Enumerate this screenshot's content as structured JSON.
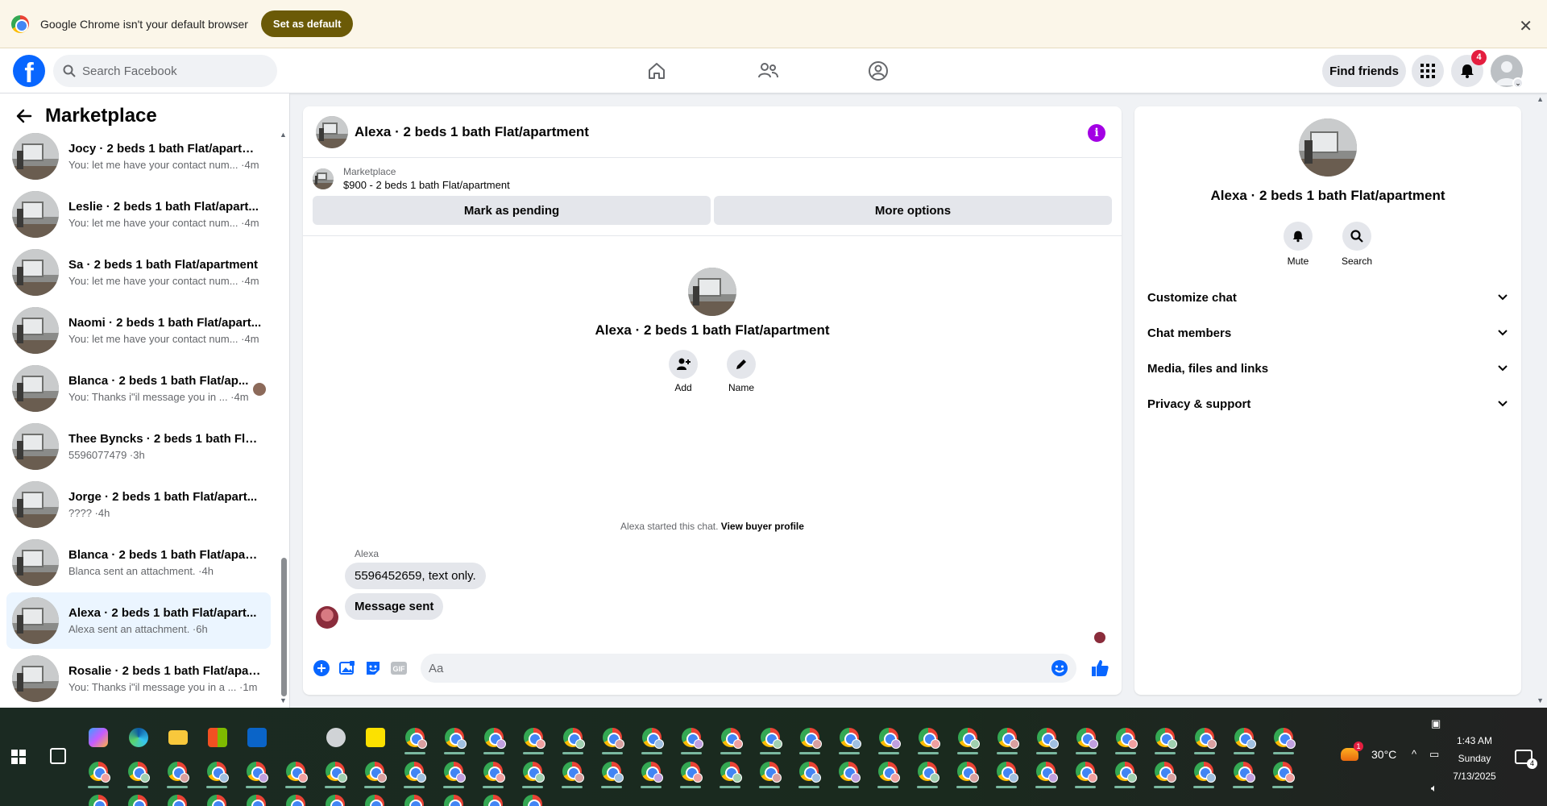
{
  "chrome_bar": {
    "message": "Google Chrome isn't your default browser",
    "set_default_label": "Set as default",
    "close_glyph": "✕"
  },
  "nav": {
    "search_placeholder": "Search Facebook",
    "find_friends_label": "Find friends",
    "notification_count": "4",
    "icons": [
      "home-icon",
      "friends-icon",
      "groups-icon",
      "menu-grid-icon",
      "bell-icon",
      "profile-icon"
    ]
  },
  "sidebar": {
    "title": "Marketplace",
    "conversations": [
      {
        "name": "Jocy · 2 beds 1 bath Flat/apartm...",
        "preview": "You: let me have your contact num... ·4m"
      },
      {
        "name": "Leslie · 2 beds 1 bath Flat/apart...",
        "preview": "You: let me have your contact num... ·4m"
      },
      {
        "name": "Sa · 2 beds 1 bath Flat/apartment",
        "preview": "You: let me have your contact num... ·4m"
      },
      {
        "name": "Naomi · 2 beds 1 bath Flat/apart...",
        "preview": "You: let me have your contact num... ·4m"
      },
      {
        "name": "Blanca · 2 beds 1 bath Flat/ap...",
        "preview": "You: Thanks i\"il message you in ... ·4m"
      },
      {
        "name": "Thee Byncks · 2 beds 1 bath Flat...",
        "preview": "5596077479 ·3h"
      },
      {
        "name": "Jorge · 2 beds 1 bath Flat/apart...",
        "preview": "???? ·4h"
      },
      {
        "name": "Blanca · 2 beds 1 bath Flat/apart...",
        "preview": "Blanca sent an attachment. ·4h"
      },
      {
        "name": "Alexa · 2 beds 1 bath Flat/apart...",
        "preview": "Alexa sent an attachment. ·6h"
      },
      {
        "name": "Rosalie · 2 beds 1 bath Flat/apar...",
        "preview": "You: Thanks i\"il message you in a ... ·1m"
      }
    ],
    "active_index": 8
  },
  "chat": {
    "title": "Alexa · 2 beds 1 bath Flat/apartment",
    "marketplace_label": "Marketplace",
    "listing": "$900 - 2 beds 1 bath Flat/apartment",
    "mark_pending_label": "Mark as pending",
    "more_options_label": "More options",
    "profile_name": "Alexa · 2 beds 1 bath Flat/apartment",
    "add_label": "Add",
    "name_label": "Name",
    "started_text": "Alexa started this chat.",
    "view_buyer_label": "View buyer profile",
    "sender": "Alexa",
    "messages": [
      "5596452659, text only.",
      "Message sent"
    ],
    "composer_placeholder": "Aa"
  },
  "details": {
    "name": "Alexa · 2 beds 1 bath Flat/apartment",
    "mute_label": "Mute",
    "search_label": "Search",
    "sections": [
      "Customize chat",
      "Chat members",
      "Media, files and links",
      "Privacy & support"
    ]
  },
  "taskbar": {
    "temperature": "30°C",
    "weather_badge": "1",
    "time": "1:43 AM",
    "day": "Sunday",
    "date": "7/13/2025",
    "notification_count": "4"
  },
  "colors": {
    "facebook_blue": "#0866ff",
    "info_purple": "#a300e4",
    "set_default_bg": "#6b5a07",
    "active_conversation": "#ebf5ff"
  }
}
